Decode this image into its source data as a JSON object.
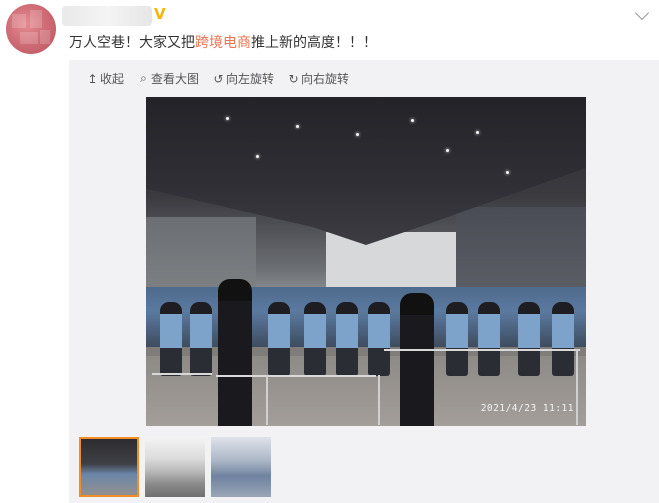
{
  "header": {
    "username": "",
    "vip_badge": "V",
    "more_icon": "chevron-down-icon"
  },
  "post": {
    "text_before": "万人空巷！大家又把",
    "text_highlight": "跨境电商",
    "text_after": "推上新的高度！！！"
  },
  "toolbar": {
    "items": [
      {
        "icon": "↥",
        "label": "收起"
      },
      {
        "icon": "⌕",
        "label": "查看大图"
      },
      {
        "icon": "↺",
        "label": "向左旋转"
      },
      {
        "icon": "↻",
        "label": "向右旋转"
      }
    ]
  },
  "photo": {
    "timestamp": "2021/4/23  11:11",
    "description": "crowd-photo"
  },
  "thumbnails": {
    "count": 3,
    "active_index": 0
  },
  "colors": {
    "highlight": "#eb7350",
    "vip": "#f5b50a",
    "active_thumb_border": "#f28c26",
    "media_bg": "#f2f2f5"
  }
}
